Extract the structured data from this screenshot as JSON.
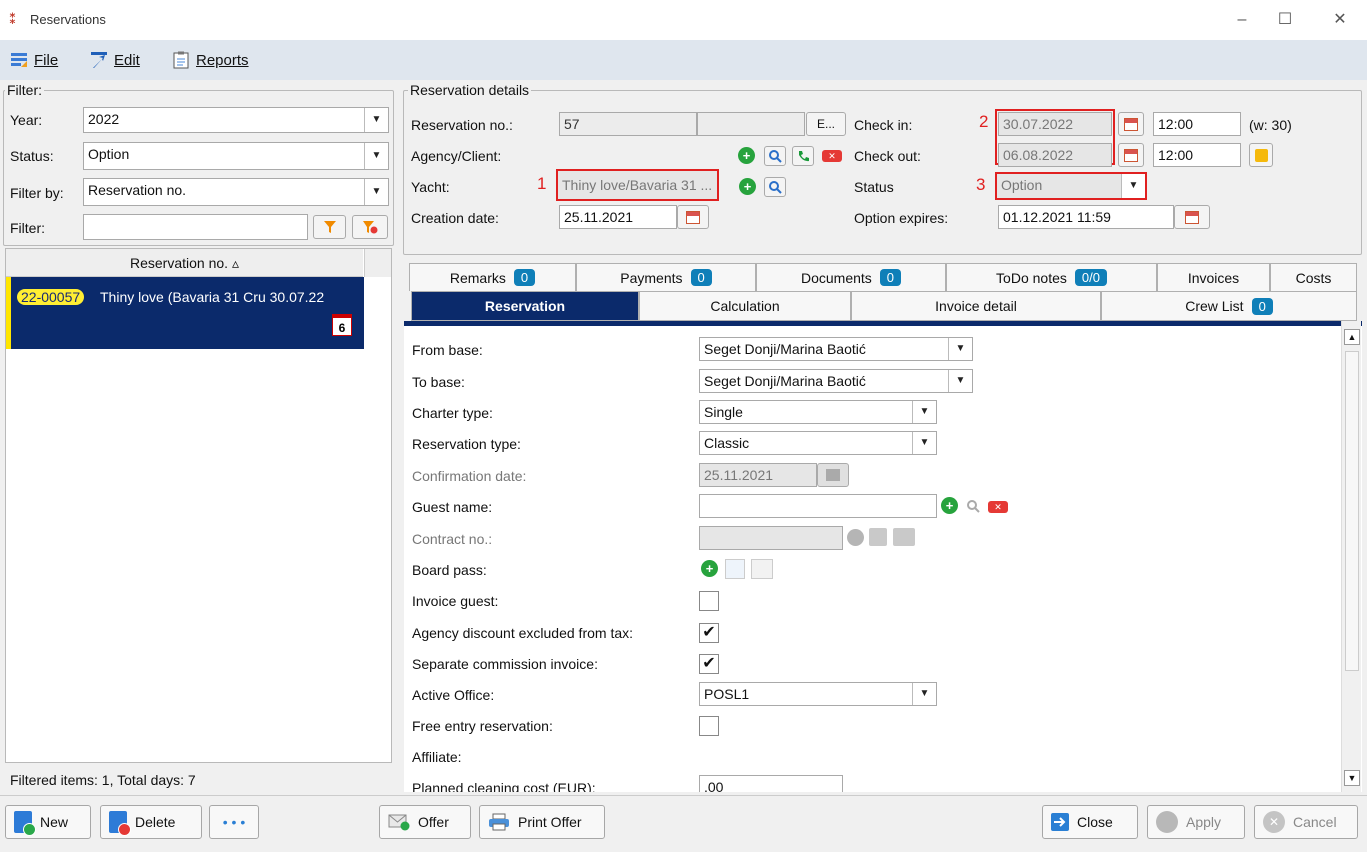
{
  "window": {
    "title": "Reservations",
    "minimize": "–",
    "maximize": "☐",
    "close": "✕"
  },
  "menu": {
    "file": "File",
    "edit": "Edit",
    "reports": "Reports"
  },
  "filter": {
    "legend": "Filter:",
    "year_label": "Year:",
    "year_value": "2022",
    "status_label": "Status:",
    "status_value": "Option",
    "filterby_label": "Filter by:",
    "filterby_value": "Reservation no.",
    "filter_label": "Filter:",
    "filter_value": ""
  },
  "list": {
    "column_header": "Reservation no. ▵",
    "rows": [
      {
        "badge": "22-00057",
        "text": "Thiny love (Bavaria 31 Cru 30.07.22",
        "days": "6"
      }
    ],
    "footer": "Filtered items: 1,  Total days: 7"
  },
  "details": {
    "legend": "Reservation details",
    "resno_label": "Reservation no.:",
    "resno_value": "57",
    "resno_extra": "",
    "resno_btn": "E...",
    "agency_label": "Agency/Client:",
    "yacht_label": "Yacht:",
    "yacht_value": "Thiny love/Bavaria 31 ...",
    "yacht_marker": "1",
    "creation_label": "Creation date:",
    "creation_value": "25.11.2021",
    "checkin_label": "Check in:",
    "checkin_date": "30.07.2022",
    "checkin_time": "12:00",
    "week": "(w: 30)",
    "date_marker": "2",
    "checkout_label": "Check out:",
    "checkout_date": "06.08.2022",
    "checkout_time": "12:00",
    "status_label": "Status",
    "status_value": "Option",
    "status_marker": "3",
    "option_label": "Option expires:",
    "option_value": "01.12.2021 11:59"
  },
  "tabs_row1": [
    {
      "label": "Remarks",
      "count": "0"
    },
    {
      "label": "Payments",
      "count": "0"
    },
    {
      "label": "Documents",
      "count": "0"
    },
    {
      "label": "ToDo notes",
      "count": "0/0"
    },
    {
      "label": "Invoices",
      "count": ""
    },
    {
      "label": "Costs",
      "count": ""
    }
  ],
  "tabs_row2": [
    {
      "label": "Reservation",
      "count": ""
    },
    {
      "label": "Calculation",
      "count": ""
    },
    {
      "label": "Invoice detail",
      "count": ""
    },
    {
      "label": "Crew List",
      "count": "0"
    }
  ],
  "form": {
    "from_base_label": "From base:",
    "from_base_value": "Seget Donji/Marina Baotić",
    "to_base_label": "To base:",
    "to_base_value": "Seget Donji/Marina Baotić",
    "charter_type_label": "Charter type:",
    "charter_type_value": "Single",
    "res_type_label": "Reservation type:",
    "res_type_value": "Classic",
    "confirm_label": "Confirmation date:",
    "confirm_value": "25.11.2021",
    "guest_label": "Guest name:",
    "guest_value": "",
    "contract_label": "Contract no.:",
    "contract_value": "",
    "boardpass_label": "Board pass:",
    "invoice_guest_label": "Invoice guest:",
    "invoice_guest_checked": "",
    "agency_discount_label": "Agency discount excluded from tax:",
    "agency_discount_checked": "✔",
    "separate_comm_label": "Separate commission invoice:",
    "separate_comm_checked": "✔",
    "active_office_label": "Active Office:",
    "active_office_value": "POSL1",
    "free_entry_label": "Free entry reservation:",
    "free_entry_checked": "",
    "affiliate_label": "Affiliate:",
    "cleaning_label": "Planned cleaning cost (EUR):",
    "cleaning_value": ".00"
  },
  "buttons": {
    "new": "New",
    "delete": "Delete",
    "more": "• • •",
    "offer": "Offer",
    "print_offer": "Print Offer",
    "close": "Close",
    "apply": "Apply",
    "cancel": "Cancel"
  }
}
